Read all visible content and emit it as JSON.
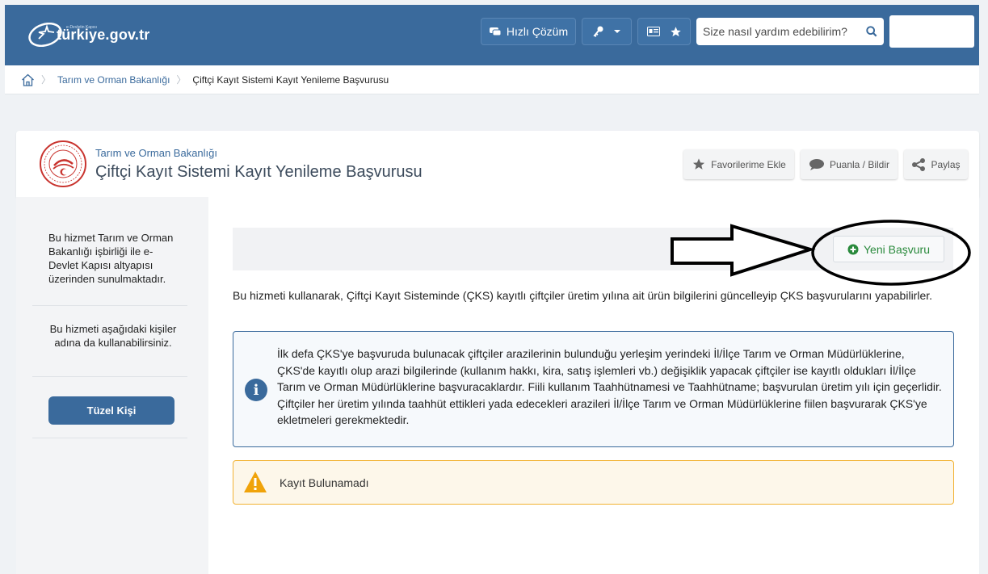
{
  "header": {
    "logo_text": "türkiye.gov.tr",
    "logo_sub": "e-Devletin Kapısı",
    "quick_label": "Hızlı Çözüm",
    "search_placeholder": "Size nasıl yardım edebilirim?"
  },
  "breadcrumb": {
    "items": [
      "Tarım ve Orman Bakanlığı",
      "Çiftçi Kayıt Sistemi Kayıt Yenileme Başvurusu"
    ]
  },
  "service": {
    "ministry": "Tarım ve Orman Bakanlığı",
    "title": "Çiftçi Kayıt Sistemi Kayıt Yenileme Başvurusu",
    "actions": {
      "favorite": "Favorilerime Ekle",
      "rate": "Puanla / Bildir",
      "share": "Paylaş"
    }
  },
  "sidebar": {
    "info": "Bu hizmet Tarım ve Orman Bakanlığı işbirliği ile e-Devlet Kapısı altyapısı üzerinden sunulmaktadır.",
    "alt_text": "Bu hizmeti aşağıdaki kişiler adına da kullanabilirsiniz.",
    "button": "Tüzel Kişi"
  },
  "main": {
    "new_button": "Yeni Başvuru",
    "description": "Bu hizmeti kullanarak, Çiftçi Kayıt Sisteminde (ÇKS) kayıtlı çiftçiler üretim yılına ait ürün bilgilerini güncelleyip ÇKS başvurularını yapabilirler.",
    "info": "İlk defa ÇKS'ye başvuruda bulunacak çiftçiler arazilerinin bulunduğu yerleşim yerindeki İl/İlçe Tarım ve Orman Müdürlüklerine, ÇKS'de kayıtlı olup arazi bilgilerinde (kullanım hakkı, kira, satış işlemleri vb.) değişiklik yapacak çiftçiler ise kayıtlı oldukları İl/İlçe Tarım ve Orman Müdürlüklerine başvuracaklardır. Fiili kullanım Taahhütnamesi ve Taahhütname; başvurulan üretim yılı için geçerlidir. Çiftçiler her üretim yılında taahhüt ettikleri yada edecekleri arazileri İl/İlçe Tarım ve Orman Müdürlüklerine fiilen başvurarak ÇKS'ye ekletmeleri gerekmektedir.",
    "warning": "Kayıt Bulunamadı"
  },
  "colors": {
    "brand": "#3a6a9c",
    "success": "#2a8a3c",
    "warning": "#f2b233"
  },
  "icons": [
    "home-icon",
    "chat-icon",
    "key-icon",
    "id-card-icon",
    "star-icon",
    "search-icon",
    "share-icon",
    "info-icon",
    "warning-icon",
    "plus-circle-icon"
  ]
}
